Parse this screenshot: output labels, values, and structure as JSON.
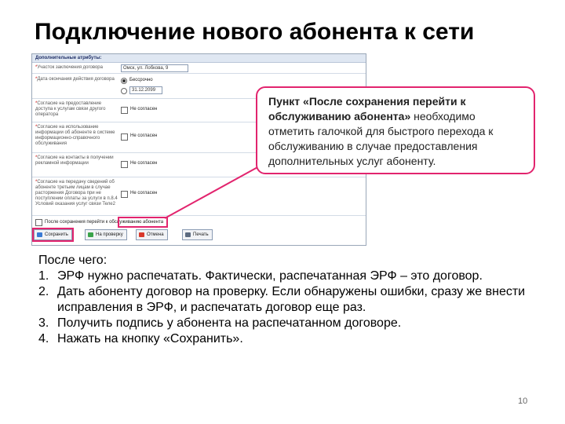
{
  "slide": {
    "title": "Подключение нового абонента к сети",
    "page_number": "10"
  },
  "form": {
    "section_header": "Дополнительные атрибуты:",
    "rows": [
      {
        "label": "Участок заключения договора",
        "input_value": "Омск, ул. Лобкова, 9"
      },
      {
        "label": "Дата окончания действия договора",
        "options": [
          "Бессрочно",
          "31.12.2099"
        ]
      },
      {
        "label": "Согласие на предоставление доступа к услугам связи другого оператора",
        "choice": "Не согласен"
      },
      {
        "label": "Согласие на использование информации об абоненте в системе информационно-справочного обслуживания",
        "choice": "Не согласен"
      },
      {
        "label": "Согласие на контакты в получении рекламной информации",
        "choice": "Не согласен"
      },
      {
        "label": "Согласие на передачу сведений об абоненте третьим лицам в случае расторжения Договора при не поступлении оплаты за услуги в п.8.4 Условий оказания услуг связи Теле2",
        "choice": "Не согласен"
      }
    ],
    "after_save_label": "После сохранения перейти к обслуживанию абонента",
    "buttons": {
      "save": "Сохранить",
      "check": "На проверку",
      "cancel": "Отмена",
      "print": "Печать"
    }
  },
  "callout": {
    "bold_part": "Пункт «После сохранения перейти к обслуживанию абонента»",
    "rest": " необходимо отметить галочкой для быстрого перехода к обслуживанию в случае предоставления дополнительных услуг абоненту."
  },
  "instructions": {
    "intro": "После чего:",
    "items": [
      {
        "num": "1.",
        "text": "ЭРФ нужно распечатать. Фактически, распечатанная ЭРФ – это договор."
      },
      {
        "num": "2.",
        "text": "Дать абоненту договор на проверку. Если обнаружены ошибки, сразу же внести исправления в ЭРФ, и распечатать договор еще раз."
      },
      {
        "num": "3.",
        "text": "Получить подпись у абонента на распечатанном договоре."
      },
      {
        "num": "4.",
        "text": "Нажать на кнопку «Сохранить»."
      }
    ]
  },
  "colors": {
    "accent_pink": "#e2246e",
    "panel_header": "#dfe7f2",
    "button_icon_save": "#3a7bd5",
    "button_icon_check": "#3aa34a",
    "button_icon_cancel": "#d8392b",
    "button_icon_print": "#5c6b80"
  }
}
